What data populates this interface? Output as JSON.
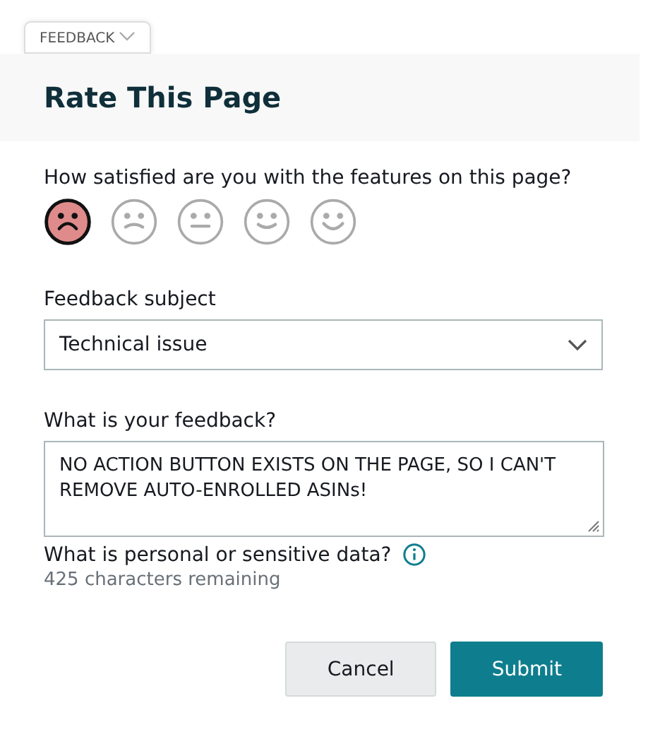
{
  "feedback_tab": {
    "label": "FEEDBACK"
  },
  "dialog": {
    "title": "Rate This Page",
    "rating": {
      "question": "How satisfied are you with the features on this page?",
      "faces": [
        {
          "kind": "frown",
          "selected": true
        },
        {
          "kind": "slight-frown",
          "selected": false
        },
        {
          "kind": "neutral",
          "selected": false
        },
        {
          "kind": "slight-smile",
          "selected": false
        },
        {
          "kind": "smile",
          "selected": false
        }
      ]
    },
    "subject": {
      "label": "Feedback subject",
      "value": "Technical issue"
    },
    "feedback": {
      "label": "What is your feedback?",
      "value": "NO ACTION BUTTON EXISTS ON THE PAGE, SO I CAN'T REMOVE AUTO-ENROLLED ASINs!"
    },
    "privacy_link": "What is personal or sensitive data?",
    "remaining": "425 characters remaining",
    "buttons": [
      {
        "kind": "secondary",
        "label": "Cancel"
      },
      {
        "kind": "primary",
        "label": "Submit"
      }
    ]
  }
}
